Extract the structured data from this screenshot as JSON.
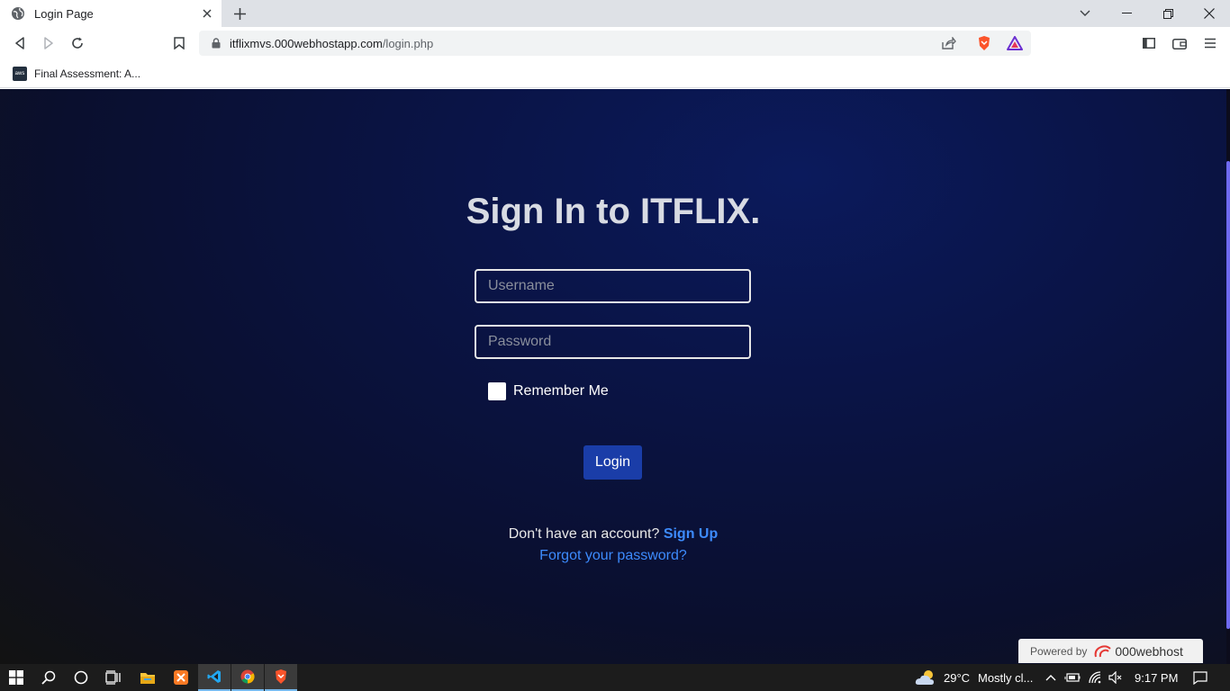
{
  "browser": {
    "tab_title": "Login Page",
    "url_host": "itflixmvs.000webhostapp.com",
    "url_path": "/login.php",
    "bookmark_label": "Final Assessment: A...",
    "bookmark_icon_text": "aws"
  },
  "page": {
    "title": "Sign In to ITFLIX.",
    "username_placeholder": "Username",
    "password_placeholder": "Password",
    "remember_label": "Remember Me",
    "login_label": "Login",
    "no_account_text": "Don't have an account? ",
    "signup_label": "Sign Up",
    "forgot_label": "Forgot your password?",
    "powered_by_text": "Powered by",
    "powered_by_brand": "000webhost"
  },
  "taskbar": {
    "weather_temp": "29°C",
    "weather_desc": "Mostly cl...",
    "clock": "9:17 PM"
  },
  "colors": {
    "accent_button": "#1a3da8",
    "link": "#3d8bfd",
    "scroll_thumb": "#6f6af0"
  }
}
